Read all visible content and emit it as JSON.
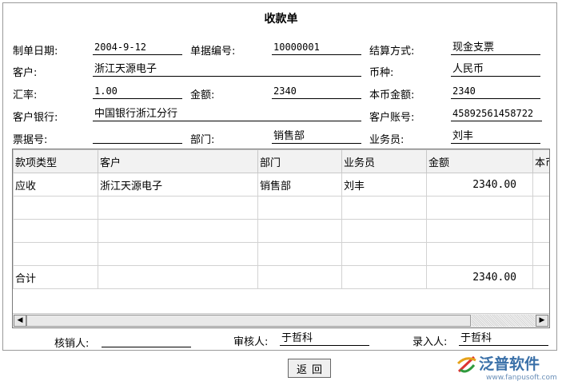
{
  "form": {
    "title": "收款单",
    "fields": {
      "date": {
        "label": "制单日期:",
        "value": "2004-9-12"
      },
      "doc_no": {
        "label": "单据编号:",
        "value": "10000001"
      },
      "settle": {
        "label": "结算方式:",
        "value": "现金支票"
      },
      "customer": {
        "label": "客户:",
        "value": "浙江天源电子"
      },
      "currency": {
        "label": "币种:",
        "value": "人民币"
      },
      "rate": {
        "label": "汇率:",
        "value": "1.00"
      },
      "amount": {
        "label": "金额:",
        "value": "2340"
      },
      "local_amount": {
        "label": "本币金额:",
        "value": "2340"
      },
      "bank": {
        "label": "客户银行:",
        "value": "中国银行浙江分行"
      },
      "account": {
        "label": "客户账号:",
        "value": "45892561458722"
      },
      "ticket": {
        "label": "票据号:",
        "value": ""
      },
      "dept": {
        "label": "部门:",
        "value": "销售部"
      },
      "staff": {
        "label": "业务员:",
        "value": "刘丰"
      }
    }
  },
  "grid": {
    "headers": [
      "款项类型",
      "客户",
      "部门",
      "业务员",
      "金额",
      "本币金额"
    ],
    "rows": [
      [
        "应收",
        "浙江天源电子",
        "销售部",
        "刘丰",
        "2340.00",
        ""
      ],
      [
        "",
        "",
        "",
        "",
        "",
        ""
      ],
      [
        "",
        "",
        "",
        "",
        "",
        ""
      ],
      [
        "",
        "",
        "",
        "",
        "",
        ""
      ],
      [
        "合计",
        "",
        "",
        "",
        "2340.00",
        ""
      ]
    ]
  },
  "scrollbar": {
    "left_arrow": "◀",
    "right_arrow": "▶"
  },
  "footer": {
    "verifier": {
      "label": "核销人:",
      "value": ""
    },
    "auditor": {
      "label": "审核人:",
      "value": "于哲科"
    },
    "entry": {
      "label": "录入人:",
      "value": "于哲科"
    },
    "back_label": "返回"
  },
  "logo": {
    "name": "泛普软件",
    "url": "www.fanpusoft.com",
    "color": "#3a70a8"
  }
}
